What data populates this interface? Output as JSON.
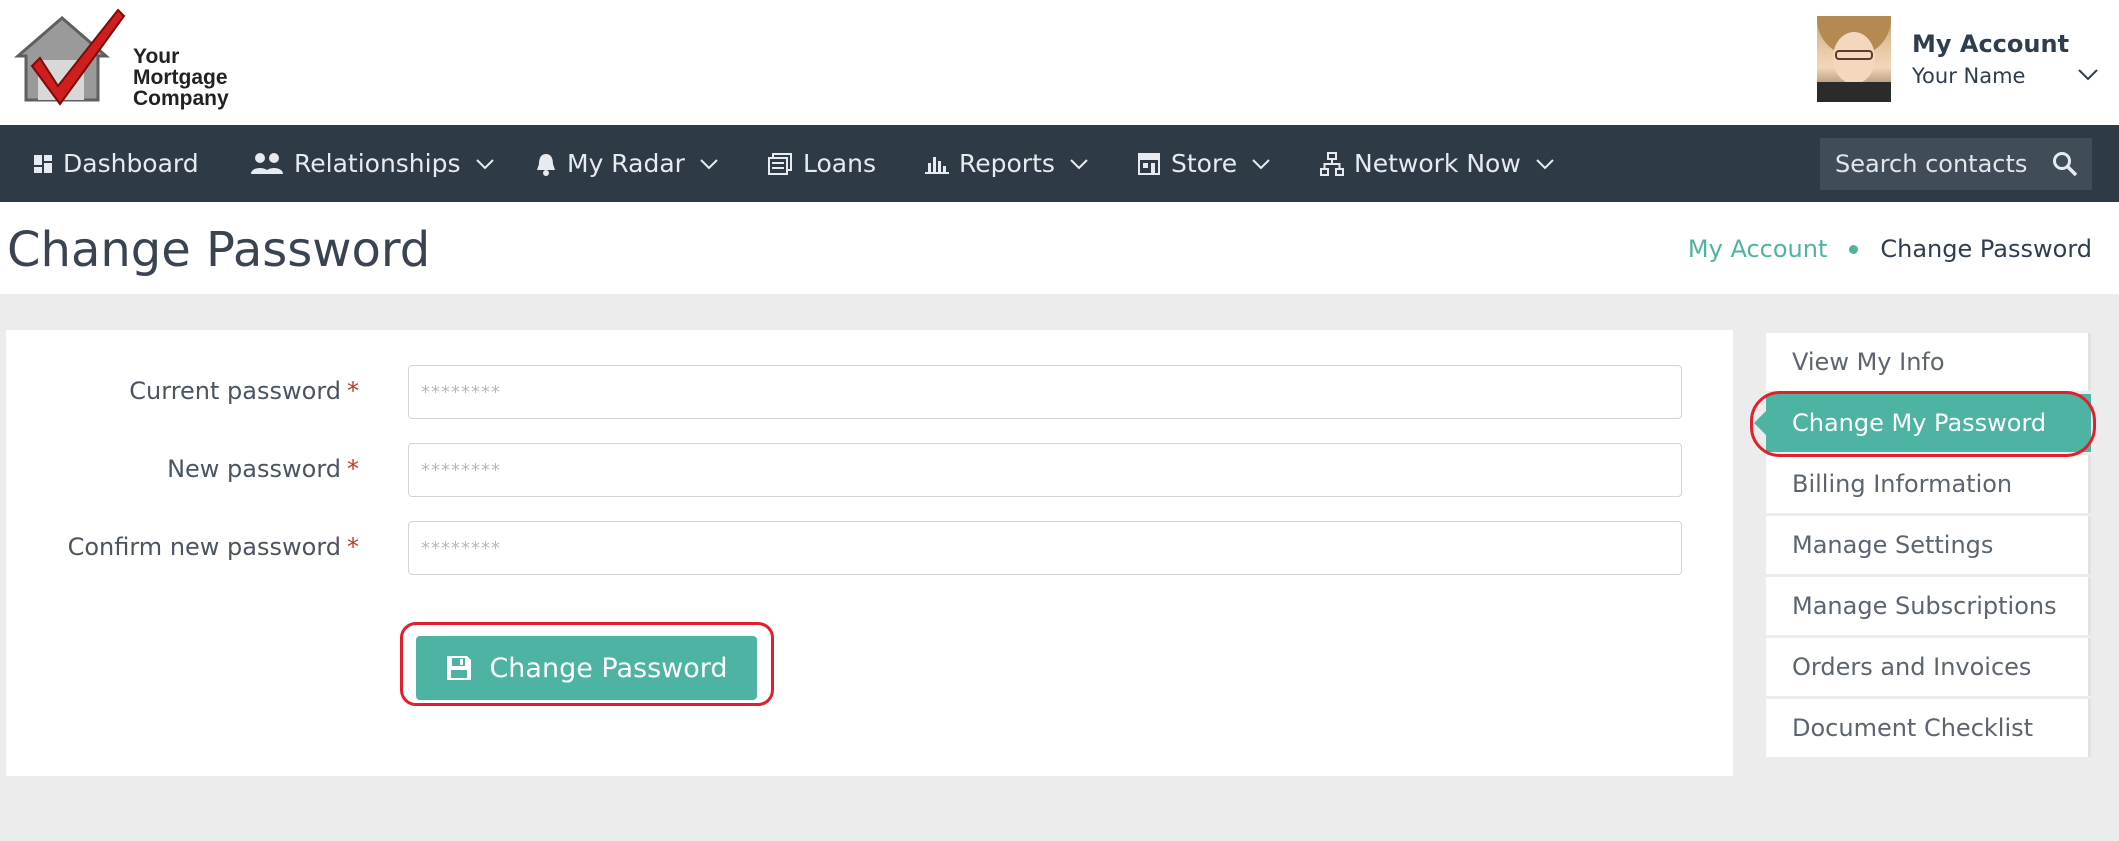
{
  "brand": {
    "logo_line1": "Your",
    "logo_line2": "Mortgage",
    "logo_line3": "Company"
  },
  "account": {
    "title": "My Account",
    "name": "Your Name"
  },
  "nav": {
    "items": [
      {
        "label": "Dashboard",
        "icon": "dashboard-icon",
        "dropdown": false
      },
      {
        "label": "Relationships",
        "icon": "users-icon",
        "dropdown": true
      },
      {
        "label": "My Radar",
        "icon": "bell-icon",
        "dropdown": true
      },
      {
        "label": "Loans",
        "icon": "documents-icon",
        "dropdown": false
      },
      {
        "label": "Reports",
        "icon": "bar-chart-icon",
        "dropdown": true
      },
      {
        "label": "Store",
        "icon": "store-icon",
        "dropdown": true
      },
      {
        "label": "Network Now",
        "icon": "network-icon",
        "dropdown": true
      }
    ],
    "search_placeholder": "Search contacts"
  },
  "page": {
    "title": "Change Password",
    "breadcrumb": {
      "parent": "My Account",
      "current": "Change Password"
    }
  },
  "form": {
    "fields": [
      {
        "label": "Current password",
        "placeholder": "********",
        "required_mark": "*"
      },
      {
        "label": "New password",
        "placeholder": "********",
        "required_mark": "*"
      },
      {
        "label": "Confirm new password",
        "placeholder": "********",
        "required_mark": "*"
      }
    ],
    "submit_label": "Change Password"
  },
  "side_menu": {
    "items": [
      {
        "label": "View My Info",
        "active": false
      },
      {
        "label": "Change My Password",
        "active": true
      },
      {
        "label": "Billing Information",
        "active": false
      },
      {
        "label": "Manage Settings",
        "active": false
      },
      {
        "label": "Manage Subscriptions",
        "active": false
      },
      {
        "label": "Orders and Invoices",
        "active": false
      },
      {
        "label": "Document Checklist",
        "active": false
      }
    ]
  },
  "colors": {
    "accent": "#4db3a2",
    "navbar": "#2e3a46",
    "highlight": "#e0202b"
  }
}
